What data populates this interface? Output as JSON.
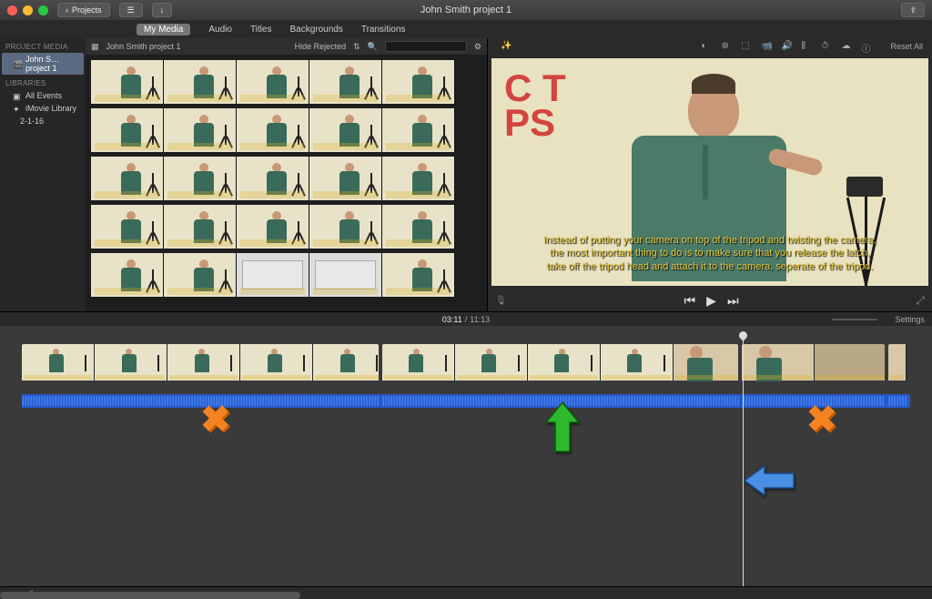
{
  "toolbar": {
    "back_label": "Projects",
    "title": "John Smith project 1"
  },
  "tabs": {
    "my_media": "My Media",
    "audio": "Audio",
    "titles": "Titles",
    "backgrounds": "Backgrounds",
    "transitions": "Transitions"
  },
  "sidebar": {
    "project_media_header": "PROJECT MEDIA",
    "project_item": "John S…project 1",
    "libraries_header": "LIBRARIES",
    "all_events": "All Events",
    "imovie_library": "iMovie Library",
    "date_item": "2-1-16"
  },
  "browser": {
    "title": "John Smith project 1",
    "filter_label": "Hide Rejected"
  },
  "viewer": {
    "reset_label": "Reset All",
    "whiteboard_line1": "C T",
    "whiteboard_line2": "PS",
    "caption_l1": "Instead of putting your camera on top of the tripod and twisting the camera,",
    "caption_l2": "the most important thing  to do is to make sure that you release the latch,",
    "caption_l3": "take off the tripod head and attach it to the camera, seperate of the tripod.",
    "prev_icon": "⏮",
    "play_icon": "▶",
    "next_icon": "⏭"
  },
  "timeline": {
    "current": "03:11",
    "total": "11:13",
    "settings_label": "Settings"
  },
  "icons": {
    "share": "⇪",
    "list": "☰",
    "import": "↓",
    "mic": "🎤",
    "full": "⤢",
    "gear": "⚙",
    "search": "🔍",
    "note": "♫"
  },
  "colors": {
    "accent_orange": "#f58220",
    "accent_green": "#2eb82e",
    "accent_blue": "#4a90e2",
    "audio_track": "#2658c8"
  }
}
